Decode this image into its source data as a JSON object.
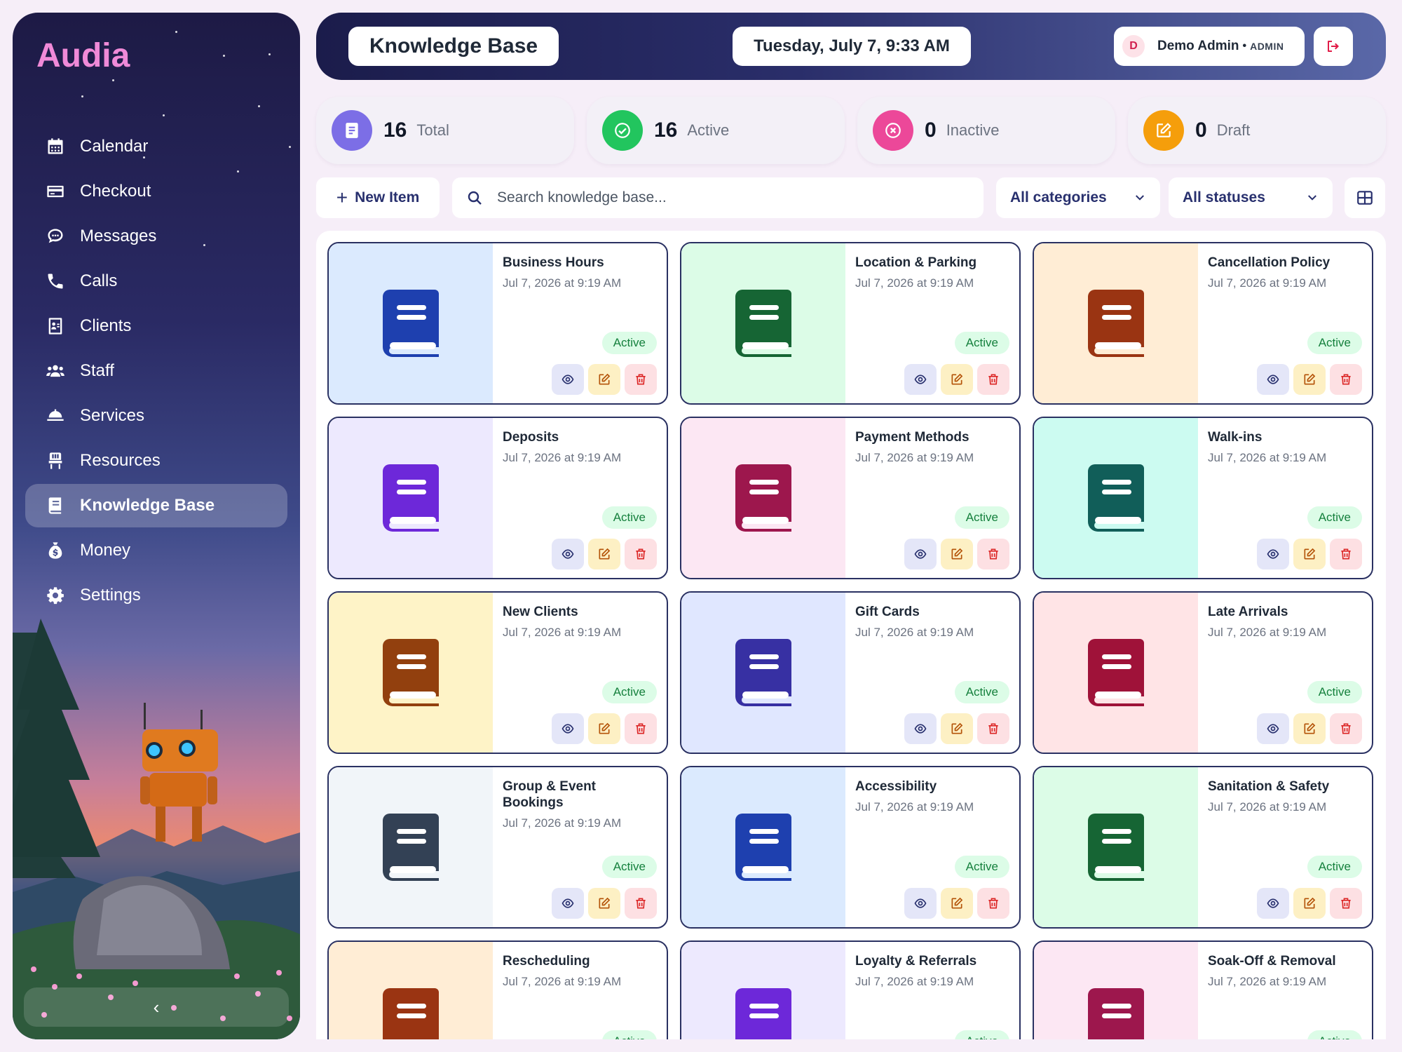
{
  "app": {
    "brand": "Audia"
  },
  "sidebar": {
    "items": [
      {
        "label": "Calendar",
        "icon": "calendar-icon",
        "active": false
      },
      {
        "label": "Checkout",
        "icon": "credit-card-icon",
        "active": false
      },
      {
        "label": "Messages",
        "icon": "chat-bubble-icon",
        "active": false
      },
      {
        "label": "Calls",
        "icon": "phone-icon",
        "active": false
      },
      {
        "label": "Clients",
        "icon": "address-card-icon",
        "active": false
      },
      {
        "label": "Staff",
        "icon": "users-icon",
        "active": false
      },
      {
        "label": "Services",
        "icon": "bell-service-icon",
        "active": false
      },
      {
        "label": "Resources",
        "icon": "chair-icon",
        "active": false
      },
      {
        "label": "Knowledge Base",
        "icon": "book-icon",
        "active": true
      },
      {
        "label": "Money",
        "icon": "money-bag-icon",
        "active": false
      },
      {
        "label": "Settings",
        "icon": "gear-icon",
        "active": false
      }
    ],
    "collapse_glyph": "‹"
  },
  "header": {
    "title": "Knowledge Base",
    "datetime": "Tuesday, July 7, 9:33 AM",
    "user": {
      "initial": "D",
      "name": "Demo Admin",
      "separator": "•",
      "role": "ADMIN"
    }
  },
  "stats": [
    {
      "value": "16",
      "label": "Total",
      "color": "#7c6ee6",
      "icon": "document-icon"
    },
    {
      "value": "16",
      "label": "Active",
      "color": "#22c55e",
      "icon": "check-circle-icon"
    },
    {
      "value": "0",
      "label": "Inactive",
      "color": "#ec4899",
      "icon": "x-circle-icon"
    },
    {
      "value": "0",
      "label": "Draft",
      "color": "#f59e0b",
      "icon": "pencil-square-icon"
    }
  ],
  "toolbar": {
    "new_label": "New Item",
    "search_placeholder": "Search knowledge base...",
    "category_select": "All categories",
    "status_select": "All statuses"
  },
  "cards": [
    {
      "title": "Business Hours",
      "date": "Jul 7, 2026 at 9:19 AM",
      "status": "Active",
      "bg": "#dbeafe",
      "fg": "#1e40af"
    },
    {
      "title": "Location & Parking",
      "date": "Jul 7, 2026 at 9:19 AM",
      "status": "Active",
      "bg": "#dcfce7",
      "fg": "#166534"
    },
    {
      "title": "Cancellation Policy",
      "date": "Jul 7, 2026 at 9:19 AM",
      "status": "Active",
      "bg": "#ffedd5",
      "fg": "#9a3412"
    },
    {
      "title": "Deposits",
      "date": "Jul 7, 2026 at 9:19 AM",
      "status": "Active",
      "bg": "#ede9fe",
      "fg": "#6d28d9"
    },
    {
      "title": "Payment Methods",
      "date": "Jul 7, 2026 at 9:19 AM",
      "status": "Active",
      "bg": "#fce7f3",
      "fg": "#9d174d"
    },
    {
      "title": "Walk-ins",
      "date": "Jul 7, 2026 at 9:19 AM",
      "status": "Active",
      "bg": "#ccfbf1",
      "fg": "#115e59"
    },
    {
      "title": "New Clients",
      "date": "Jul 7, 2026 at 9:19 AM",
      "status": "Active",
      "bg": "#fef3c7",
      "fg": "#92400e"
    },
    {
      "title": "Gift Cards",
      "date": "Jul 7, 2026 at 9:19 AM",
      "status": "Active",
      "bg": "#e0e7ff",
      "fg": "#3730a3"
    },
    {
      "title": "Late Arrivals",
      "date": "Jul 7, 2026 at 9:19 AM",
      "status": "Active",
      "bg": "#ffe4e6",
      "fg": "#9f1239"
    },
    {
      "title": "Group & Event Bookings",
      "date": "Jul 7, 2026 at 9:19 AM",
      "status": "Active",
      "bg": "#f1f5f9",
      "fg": "#334155"
    },
    {
      "title": "Accessibility",
      "date": "Jul 7, 2026 at 9:19 AM",
      "status": "Active",
      "bg": "#dbeafe",
      "fg": "#1e40af"
    },
    {
      "title": "Sanitation & Safety",
      "date": "Jul 7, 2026 at 9:19 AM",
      "status": "Active",
      "bg": "#dcfce7",
      "fg": "#166534"
    },
    {
      "title": "Rescheduling",
      "date": "Jul 7, 2026 at 9:19 AM",
      "status": "Active",
      "bg": "#ffedd5",
      "fg": "#9a3412"
    },
    {
      "title": "Loyalty & Referrals",
      "date": "Jul 7, 2026 at 9:19 AM",
      "status": "Active",
      "bg": "#ede9fe",
      "fg": "#6d28d9"
    },
    {
      "title": "Soak-Off & Removal",
      "date": "Jul 7, 2026 at 9:19 AM",
      "status": "Active",
      "bg": "#fce7f3",
      "fg": "#9d174d"
    }
  ]
}
